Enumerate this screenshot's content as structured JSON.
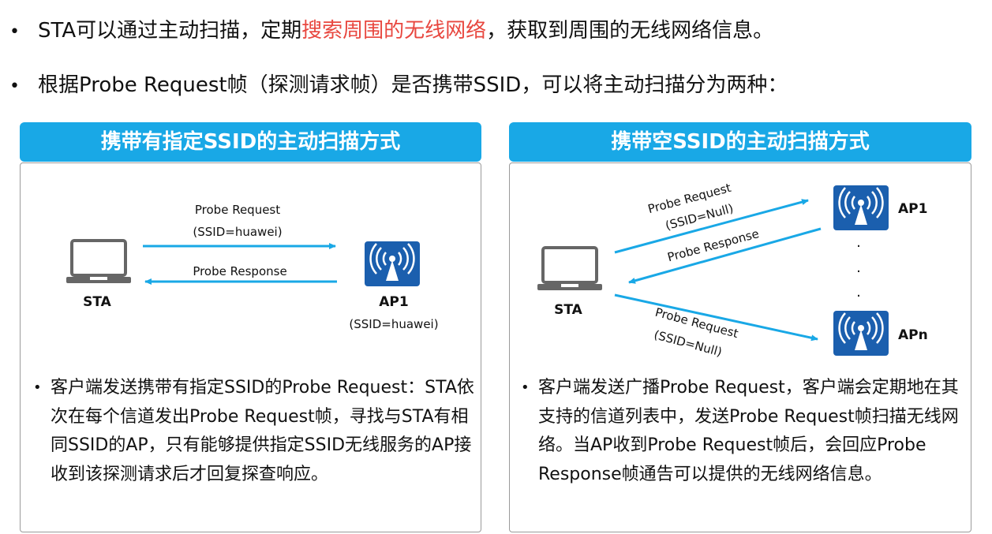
{
  "intro": {
    "line1_before": "STA可以通过主动扫描，定期",
    "line1_highlight": "搜索周围的无线网络",
    "line1_after": "，获取到周围的无线网络信息。",
    "line2": "根据Probe Request帧（探测请求帧）是否携带SSID，可以将主动扫描分为两种："
  },
  "left_panel": {
    "title": "携带有指定SSID的主动扫描方式",
    "sta_label": "STA",
    "ap_label": "AP1",
    "ap_ssid": "(SSID=huawei)",
    "request_label": "Probe Request",
    "request_ssid": "(SSID=huawei)",
    "response_label": "Probe Response",
    "description": "客户端发送携带有指定SSID的Probe Request：STA依次在每个信道发出Probe Request帧，寻找与STA有相同SSID的AP，只有能够提供指定SSID无线服务的AP接收到该探测请求后才回复探查响应。"
  },
  "right_panel": {
    "title": "携带空SSID的主动扫描方式",
    "sta_label": "STA",
    "ap1_label": "AP1",
    "apn_label": "APn",
    "dots": "·",
    "request1_label": "Probe Request",
    "request1_ssid": "(SSID=Null)",
    "response_label": "Probe Response",
    "request2_label": "Probe Request",
    "request2_ssid": "(SSID=Null)",
    "description": "客户端发送广播Probe Request，客户端会定期地在其支持的信道列表中，发送Probe Request帧扫描无线网络。当AP收到Probe Request帧后，会回应Probe Response帧通告可以提供的无线网络信息。"
  },
  "colors": {
    "accent": "#19a8e6",
    "arrow": "#19a8e6",
    "ap_icon": "#1b5fae",
    "highlight": "#e8473f"
  }
}
